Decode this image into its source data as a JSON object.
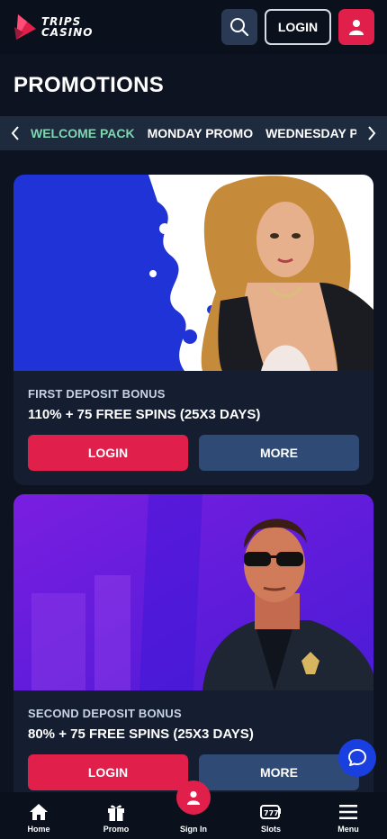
{
  "header": {
    "logo_line1": "TRIPS",
    "logo_line2": "CASINO",
    "login_label": "LOGIN"
  },
  "page": {
    "title": "PROMOTIONS"
  },
  "tabs": [
    {
      "label": "WELCOME PACK",
      "active": true
    },
    {
      "label": "MONDAY PROMO",
      "active": false
    },
    {
      "label": "WEDNESDAY PROMO",
      "active": false
    }
  ],
  "cards": [
    {
      "label": "FIRST DEPOSIT BONUS",
      "title": "110% + 75 FREE SPINS (25X3 DAYS)",
      "login_label": "LOGIN",
      "more_label": "MORE"
    },
    {
      "label": "SECOND DEPOSIT BONUS",
      "title": "80% + 75 FREE SPINS (25X3 DAYS)",
      "login_label": "LOGIN",
      "more_label": "MORE"
    }
  ],
  "bottom_nav": [
    {
      "label": "Home",
      "icon": "home-icon"
    },
    {
      "label": "Promo",
      "icon": "gift-icon"
    },
    {
      "label": "Sign In",
      "icon": "user-icon"
    },
    {
      "label": "Slots",
      "icon": "slots-icon"
    },
    {
      "label": "Menu",
      "icon": "menu-icon"
    }
  ],
  "colors": {
    "accent_red": "#e0204a",
    "active_tab": "#7fd6b0",
    "more_button": "#2f4b75",
    "chat_blue": "#1a3fe0"
  }
}
